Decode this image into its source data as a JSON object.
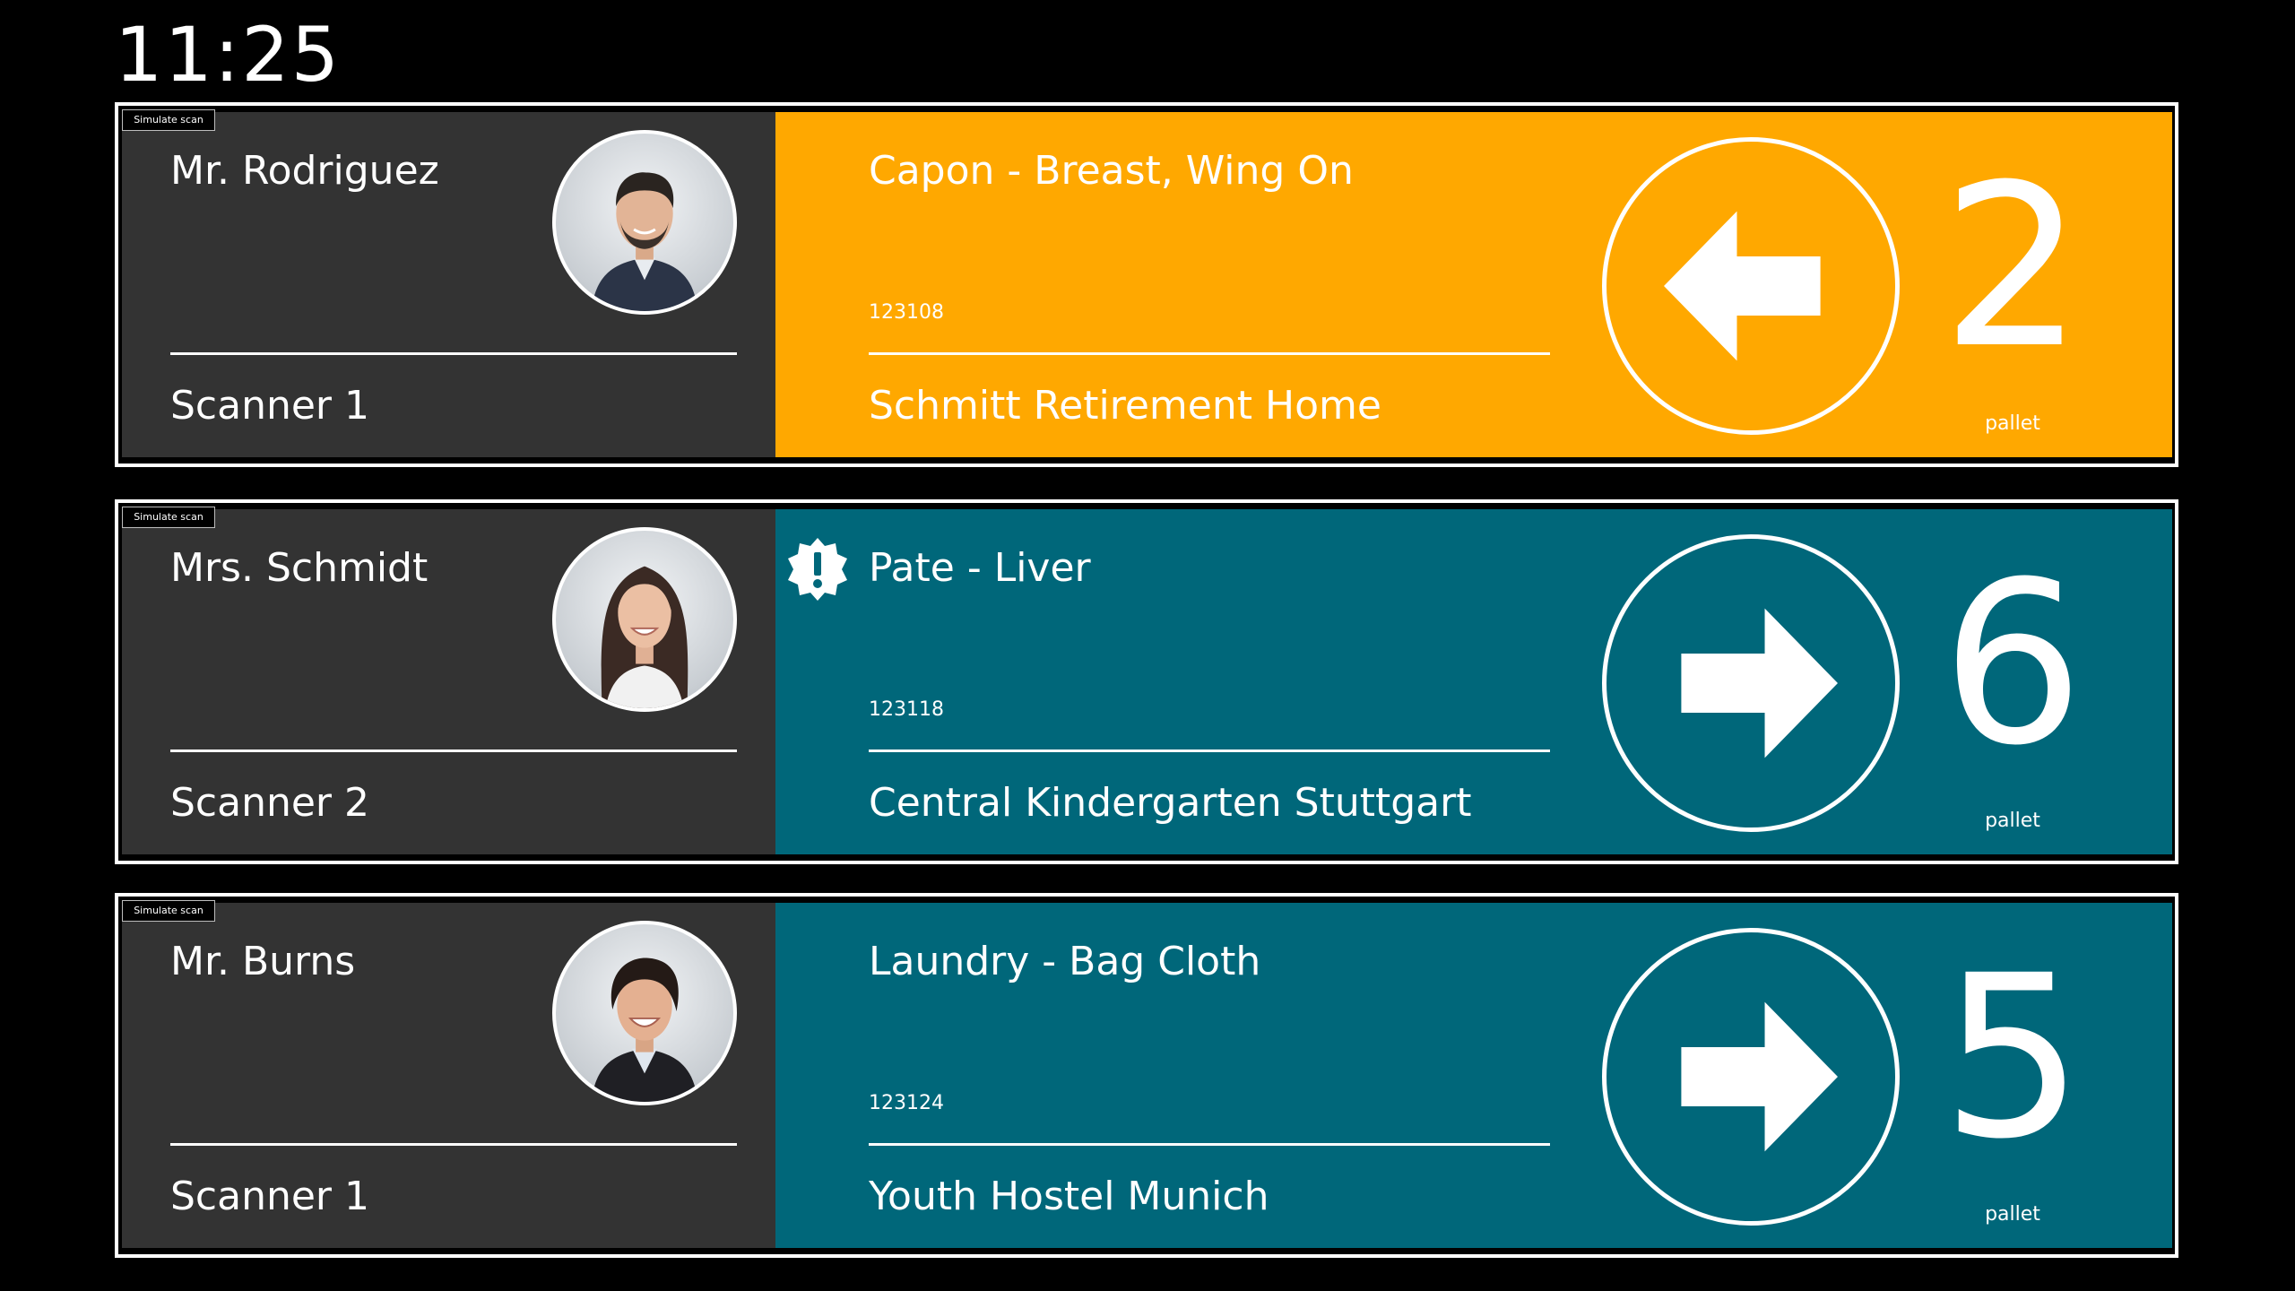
{
  "clock": "11:25",
  "colors": {
    "background": "#000000",
    "left_panel": "#333333",
    "orange": "#FFA800",
    "teal": "#00677A",
    "text": "#FFFFFF"
  },
  "rows": [
    {
      "simulate_label": "Simulate scan",
      "person": "Mr. Rodriguez",
      "scanner": "Scanner 1",
      "product": "Capon - Breast, Wing On",
      "article_no": "123108",
      "destination": "Schmitt Retirement Home",
      "direction": "left",
      "direction_icon": "arrow-left-icon",
      "quantity": "2",
      "unit": "pallet",
      "panel_color": "#FFA800",
      "alert": false
    },
    {
      "simulate_label": "Simulate scan",
      "person": "Mrs. Schmidt",
      "scanner": "Scanner 2",
      "product": "Pate - Liver",
      "article_no": "123118",
      "destination": "Central Kindergarten Stuttgart",
      "direction": "right",
      "direction_icon": "arrow-right-icon",
      "quantity": "6",
      "unit": "pallet",
      "panel_color": "#00677A",
      "alert": true,
      "alert_icon": "alert-badge-icon"
    },
    {
      "simulate_label": "Simulate scan",
      "person": "Mr. Burns",
      "scanner": "Scanner 1",
      "product": "Laundry - Bag Cloth",
      "article_no": "123124",
      "destination": "Youth Hostel Munich",
      "direction": "right",
      "direction_icon": "arrow-right-icon",
      "quantity": "5",
      "unit": "pallet",
      "panel_color": "#00677A",
      "alert": false
    }
  ]
}
